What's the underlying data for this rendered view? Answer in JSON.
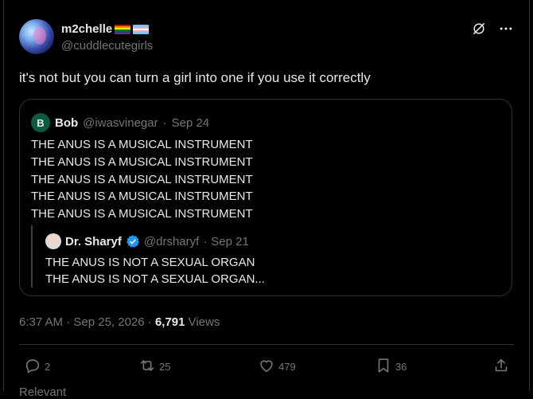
{
  "author": {
    "display_name": "m2chelle",
    "handle": "@cuddlecutegirls"
  },
  "tweet": {
    "text": "it's not but you can turn a girl into one if you use it correctly"
  },
  "quote": {
    "avatar_letter": "B",
    "name": "Bob",
    "handle": "@iwasvinegar",
    "separator": "·",
    "date": "Sep 24",
    "lines": [
      "THE ANUS IS A MUSICAL INSTRUMENT",
      "THE ANUS IS A MUSICAL INSTRUMENT",
      "THE ANUS IS A MUSICAL INSTRUMENT",
      "THE ANUS IS A MUSICAL INSTRUMENT",
      "THE ANUS IS A MUSICAL INSTRUMENT"
    ],
    "nested": {
      "name": "Dr. Sharyf",
      "handle": "@drsharyf",
      "separator": "·",
      "date": "Sep 21",
      "lines": [
        "THE ANUS IS NOT A SEXUAL ORGAN",
        "THE ANUS IS NOT A SEXUAL ORGAN..."
      ]
    }
  },
  "meta": {
    "time": "6:37 AM · Sep 25, 2026 ·",
    "views_count": "6,791",
    "views_label": "Views"
  },
  "actions": {
    "replies": "2",
    "reposts": "25",
    "likes": "479",
    "bookmarks": "36"
  },
  "footer": {
    "partial_text": "Relevant"
  },
  "colors": {
    "background": "#000000",
    "text": "#e7e9ea",
    "muted": "#71767b",
    "border": "#2f3336",
    "verified": "#1d9bf0"
  },
  "icons": [
    "grok-icon",
    "more-icon",
    "reply-icon",
    "repost-icon",
    "like-icon",
    "bookmark-icon",
    "share-icon",
    "verified-badge-icon"
  ]
}
